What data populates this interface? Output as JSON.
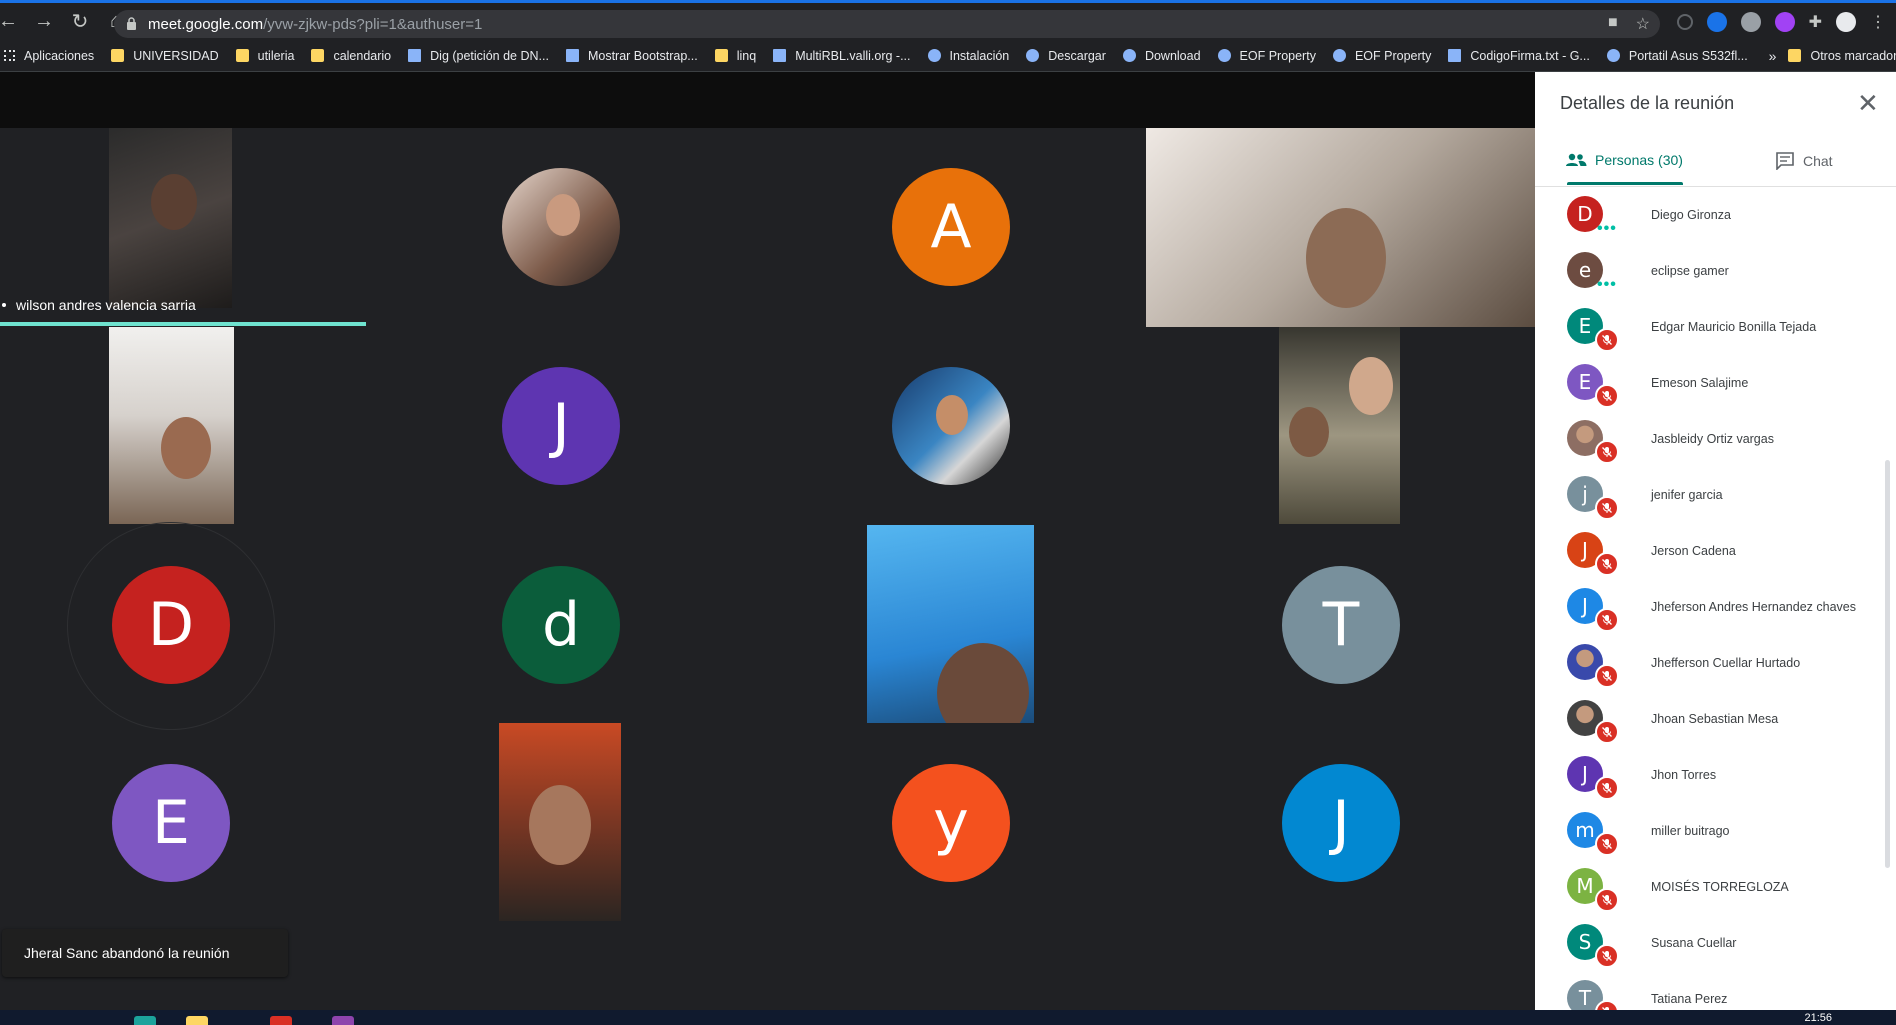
{
  "browser": {
    "url_host": "meet.google.com",
    "url_path": "/yvw-zjkw-pds?pli=1&authuser=1"
  },
  "bookmarks": [
    {
      "label": "Aplicaciones",
      "icon": "apps-grid-icon"
    },
    {
      "label": "UNIVERSIDAD",
      "icon": "folder-icon"
    },
    {
      "label": "utileria",
      "icon": "folder-icon"
    },
    {
      "label": "calendario",
      "icon": "folder-icon"
    },
    {
      "label": "Dig (petición de DN...",
      "icon": "t-letter-icon"
    },
    {
      "label": "Mostrar Bootstrap...",
      "icon": "bookmark-icon"
    },
    {
      "label": "linq",
      "icon": "folder-icon"
    },
    {
      "label": "MultiRBL.valli.org -...",
      "icon": "page-icon"
    },
    {
      "label": "Instalación",
      "icon": "globe-icon"
    },
    {
      "label": "Descargar",
      "icon": "globe-icon"
    },
    {
      "label": "Download",
      "icon": "globe-icon"
    },
    {
      "label": "EOF Property",
      "icon": "globe-icon"
    },
    {
      "label": "EOF Property",
      "icon": "globe-icon"
    },
    {
      "label": "CodigoFirma.txt - G...",
      "icon": "doc-icon"
    },
    {
      "label": "Portatil Asus S532fl...",
      "icon": "asus-icon"
    }
  ],
  "bookmarks_more": "»",
  "bookmarks_other": "Otros marcadores",
  "meeting": {
    "active_speaker_name": "wilson andres valencia sarria",
    "avatars": {
      "a": "A",
      "j1": "J",
      "d": "D",
      "d_lower": "d",
      "t": "T",
      "e": "E",
      "y": "y",
      "j2": "J"
    },
    "toast": "Jheral Sanc abandonó la reunión"
  },
  "panel": {
    "title": "Detalles de la reunión",
    "tab_people": "Personas (30)",
    "tab_chat": "Chat",
    "people": [
      {
        "name": "Diego Gironza",
        "initial": "D",
        "color": "#c5221f",
        "status": "speaking"
      },
      {
        "name": "eclipse gamer",
        "initial": "e",
        "color": "#6d4c41",
        "status": "speaking"
      },
      {
        "name": "Edgar Mauricio Bonilla Tejada",
        "initial": "E",
        "color": "#00897b",
        "status": "muted"
      },
      {
        "name": "Emeson Salajime",
        "initial": "E",
        "color": "#7e57c2",
        "status": "muted"
      },
      {
        "name": "Jasbleidy Ortiz vargas",
        "initial": "",
        "color": "#8d6e63",
        "status": "muted"
      },
      {
        "name": "jenifer garcia",
        "initial": "j",
        "color": "#78909c",
        "status": "muted"
      },
      {
        "name": "Jerson Cadena",
        "initial": "J",
        "color": "#d84315",
        "status": "muted"
      },
      {
        "name": "Jheferson Andres Hernandez chaves",
        "initial": "J",
        "color": "#1e88e5",
        "status": "muted"
      },
      {
        "name": "Jhefferson Cuellar Hurtado",
        "initial": "",
        "color": "#3949ab",
        "status": "muted"
      },
      {
        "name": "Jhoan Sebastian Mesa",
        "initial": "",
        "color": "#424242",
        "status": "muted"
      },
      {
        "name": "Jhon Torres",
        "initial": "J",
        "color": "#5e35b1",
        "status": "muted"
      },
      {
        "name": "miller buitrago",
        "initial": "m",
        "color": "#1e88e5",
        "status": "muted"
      },
      {
        "name": "MOISÉS TORREGLOZA",
        "initial": "M",
        "color": "#7cb342",
        "status": "muted"
      },
      {
        "name": "Susana Cuellar",
        "initial": "S",
        "color": "#00897b",
        "status": "muted"
      },
      {
        "name": "Tatiana Perez",
        "initial": "T",
        "color": "#78909c",
        "status": "muted"
      }
    ]
  },
  "taskbar": {
    "clock": "21:56"
  },
  "colors": {
    "accent_teal": "#00796b",
    "active_border": "#6fe3cf",
    "muted_red": "#d93025",
    "avatar_orange": "#e8710a",
    "avatar_purple": "#5e35b1",
    "avatar_red": "#c5221f",
    "avatar_green": "#0b5d3b",
    "avatar_gray": "#78909c",
    "avatar_violet": "#7e57c2",
    "avatar_deeporange": "#f4511e",
    "avatar_blue": "#0288d1"
  }
}
